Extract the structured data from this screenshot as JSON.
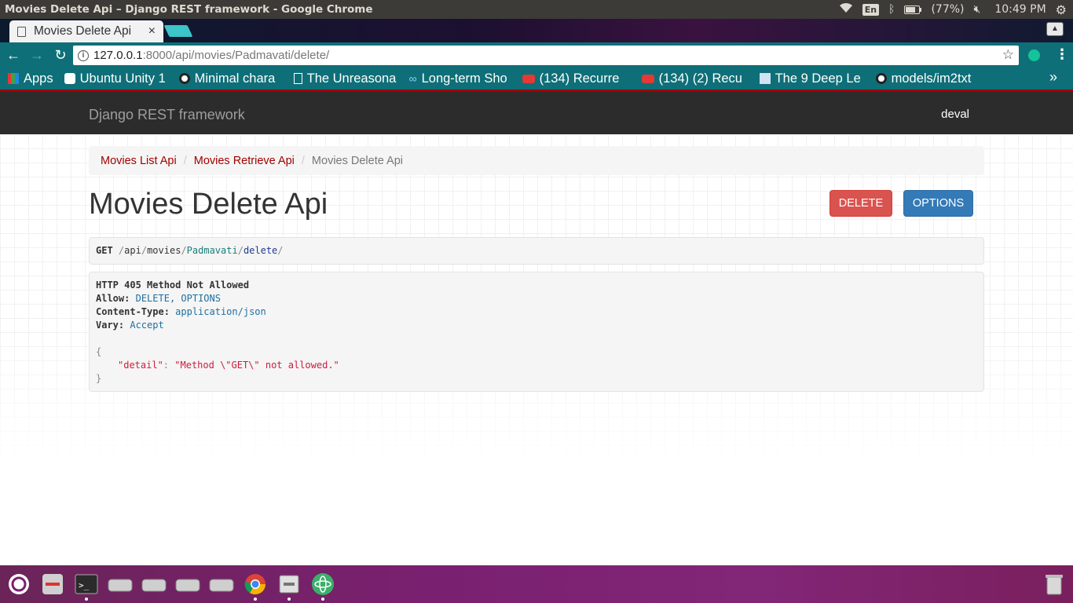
{
  "os": {
    "window_title": "Movies Delete Api – Django REST framework - Google Chrome",
    "lang": "En",
    "battery": "(77%)",
    "time": "10:49 PM"
  },
  "browser": {
    "tab_title": "Movies Delete Api",
    "url_host": "127.0.0.1",
    "url_path": ":8000/api/movies/Padmavati/delete/",
    "bookmarks": [
      {
        "label": "Apps",
        "icon": "apps-grid-icon"
      },
      {
        "label": "Ubuntu Unity 1",
        "icon": "cu-icon"
      },
      {
        "label": "Minimal chara",
        "icon": "github-icon"
      },
      {
        "label": "The Unreasona",
        "icon": "document-icon"
      },
      {
        "label": "Long-term Sho",
        "icon": "link-icon"
      },
      {
        "label": "(134) Recurre",
        "icon": "youtube-icon"
      },
      {
        "label": "(134) (2) Recu",
        "icon": "youtube-icon"
      },
      {
        "label": "The 9 Deep Le",
        "icon": "image-icon"
      },
      {
        "label": "models/im2txt",
        "icon": "github-icon"
      }
    ],
    "more_bookmarks": "»"
  },
  "drf": {
    "brand": "Django REST framework",
    "user": "deval",
    "breadcrumb": [
      "Movies List Api",
      "Movies Retrieve Api",
      "Movies Delete Api"
    ],
    "heading": "Movies Delete Api",
    "delete_label": "DELETE",
    "options_label": "OPTIONS",
    "request": {
      "method": "GET",
      "path_parts": [
        "/",
        "api",
        "/",
        "movies",
        "/",
        "Padmavati",
        "/",
        "delete",
        "/"
      ]
    },
    "response": {
      "status": "HTTP 405 Method Not Allowed",
      "headers": [
        {
          "name": "Allow:",
          "value": "DELETE, OPTIONS"
        },
        {
          "name": "Content-Type:",
          "value": "application/json"
        },
        {
          "name": "Vary:",
          "value": "Accept"
        }
      ],
      "open_brace": "{",
      "key": "\"detail\"",
      "colon": ":",
      "value": "\"Method \\\"GET\\\" not allowed.\"",
      "close_brace": "}"
    }
  }
}
